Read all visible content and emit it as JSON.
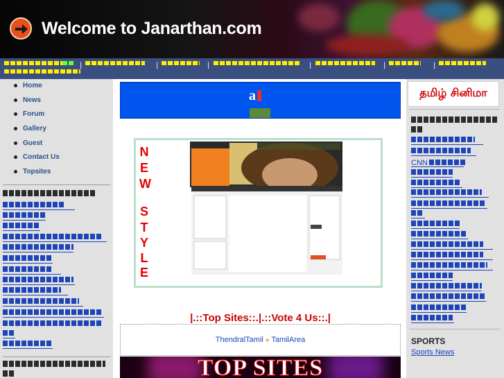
{
  "header": {
    "title": "Welcome to Janarthan.com"
  },
  "left_menu": {
    "items": [
      {
        "label": "Home"
      },
      {
        "label": "News"
      },
      {
        "label": "Forum"
      },
      {
        "label": "Gallery"
      },
      {
        "label": "Guest"
      },
      {
        "label": "Contact Us"
      },
      {
        "label": "Topsites"
      }
    ]
  },
  "center": {
    "banner_badge": "a",
    "new_style_letters": [
      "N",
      "E",
      "W",
      "",
      "S",
      "T",
      "Y",
      "L",
      "E"
    ],
    "top_sites_heading": "|.::Top Sites::.|.::Vote 4 Us::.|",
    "top_site_links": [
      {
        "label": "ThendralTamil"
      },
      {
        "label": "TamilArea"
      }
    ],
    "topsites_banner_text": "TOP SITES"
  },
  "right": {
    "tamil_cinema_banner": "தமிழ் சினிமா",
    "cnn_label": "CNN",
    "sports_heading": "SPORTS",
    "sports_news_link": "Sports News"
  },
  "colors": {
    "navbar": "#3b4e80",
    "sidebar_bg": "#e1e1e1",
    "link": "#1d44b8",
    "nav_text": "#ffee00",
    "heading_red": "#cc0000"
  }
}
